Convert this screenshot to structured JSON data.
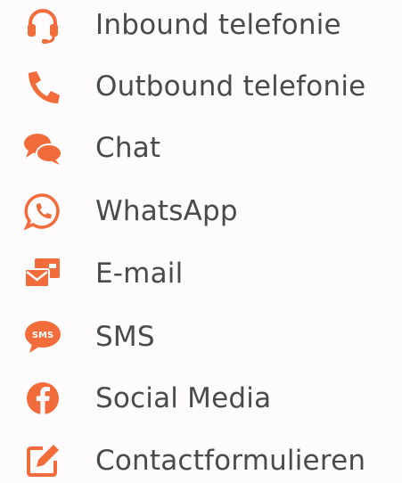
{
  "accent_color": "#f26b3a",
  "text_color": "#4a4a4a",
  "channels": [
    {
      "icon": "headset-icon",
      "label": "Inbound telefonie"
    },
    {
      "icon": "phone-icon",
      "label": "Outbound telefonie"
    },
    {
      "icon": "chat-bubbles-icon",
      "label": "Chat"
    },
    {
      "icon": "whatsapp-icon",
      "label": "WhatsApp"
    },
    {
      "icon": "mail-icon",
      "label": "E-mail"
    },
    {
      "icon": "sms-bubble-icon",
      "label": "SMS",
      "icon_text": "SMS"
    },
    {
      "icon": "facebook-icon",
      "label": "Social Media"
    },
    {
      "icon": "edit-form-icon",
      "label": "Contactformulieren"
    }
  ]
}
